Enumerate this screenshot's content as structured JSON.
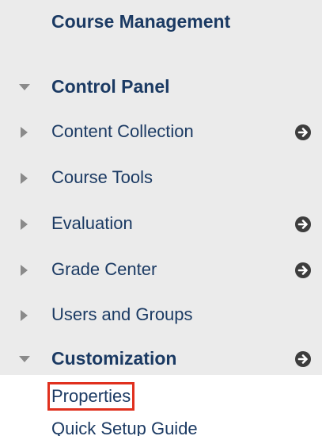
{
  "menu": {
    "title": "Course Management",
    "items": [
      {
        "label": "Control Panel",
        "expanded": true,
        "bold": true,
        "go": false
      },
      {
        "label": "Content Collection",
        "expanded": false,
        "bold": false,
        "go": true
      },
      {
        "label": "Course Tools",
        "expanded": false,
        "bold": false,
        "go": false
      },
      {
        "label": "Evaluation",
        "expanded": false,
        "bold": false,
        "go": true
      },
      {
        "label": "Grade Center",
        "expanded": false,
        "bold": false,
        "go": true
      },
      {
        "label": "Users and Groups",
        "expanded": false,
        "bold": false,
        "go": false
      },
      {
        "label": "Customization",
        "expanded": true,
        "bold": true,
        "go": true
      }
    ],
    "sub_items": [
      {
        "label": "Properties",
        "highlighted": true
      },
      {
        "label": "Quick Setup Guide",
        "highlighted": false
      }
    ]
  },
  "colors": {
    "panel_bg": "#ebebeb",
    "text": "#1b3a63",
    "icon": "#3d3d3d",
    "highlight_border": "#e0301e"
  }
}
